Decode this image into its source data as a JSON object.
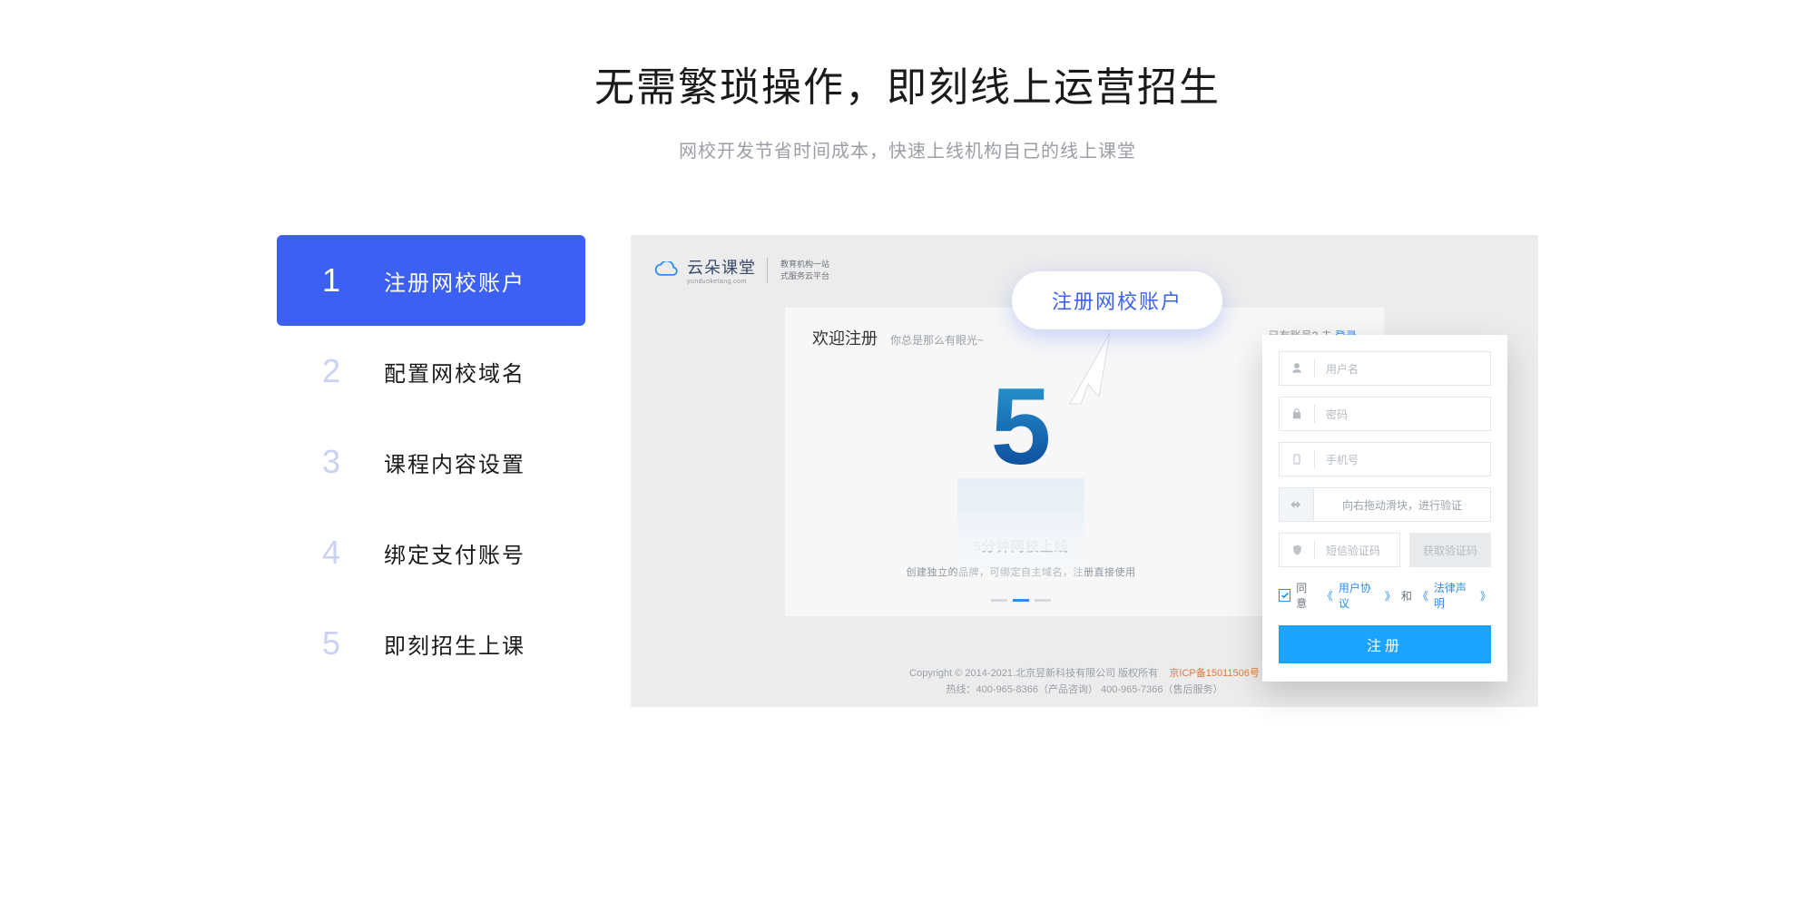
{
  "headline": "无需繁琐操作，即刻线上运营招生",
  "subheadline": "网校开发节省时间成本，快速上线机构自己的线上课堂",
  "steps": [
    {
      "num": "1",
      "label": "注册网校账户",
      "active": true
    },
    {
      "num": "2",
      "label": "配置网校域名",
      "active": false
    },
    {
      "num": "3",
      "label": "课程内容设置",
      "active": false
    },
    {
      "num": "4",
      "label": "绑定支付账号",
      "active": false
    },
    {
      "num": "5",
      "label": "即刻招生上课",
      "active": false
    }
  ],
  "preview": {
    "logo_name": "云朵课堂",
    "logo_domain": "yunduoketang.com",
    "logo_tag_line1": "教育机构一站",
    "logo_tag_line2": "式服务云平台",
    "card": {
      "title": "欢迎注册",
      "subtitle": "你总是那么有眼光~",
      "login_prefix": "已有账号? 去 ",
      "login_link": "登录",
      "hero_num": "5",
      "hero_title": "5分钟网校上线",
      "hero_desc": "创建独立的品牌，可绑定自主域名，注册直接使用"
    },
    "tooltip": "注册网校账户",
    "form": {
      "username": "用户名",
      "password": "密码",
      "phone": "手机号",
      "slider": "向右拖动滑块，进行验证",
      "code": "短信验证码",
      "code_button": "获取验证码",
      "agree_prefix": "同意",
      "agree_ua_open": "《",
      "agree_ua": "用户协议",
      "agree_ua_close": "》",
      "agree_and": "和",
      "agree_law_open": "《",
      "agree_law": "法律声明",
      "agree_law_close": "》",
      "submit": "注册"
    },
    "footer": {
      "copyright": "Copyright © 2014-2021.北京昱新科技有限公司 版权所有",
      "icp": "京ICP备15011506号",
      "hotline": "热线：400-965-8366（产品咨询） 400-965-7366（售后服务）"
    }
  }
}
